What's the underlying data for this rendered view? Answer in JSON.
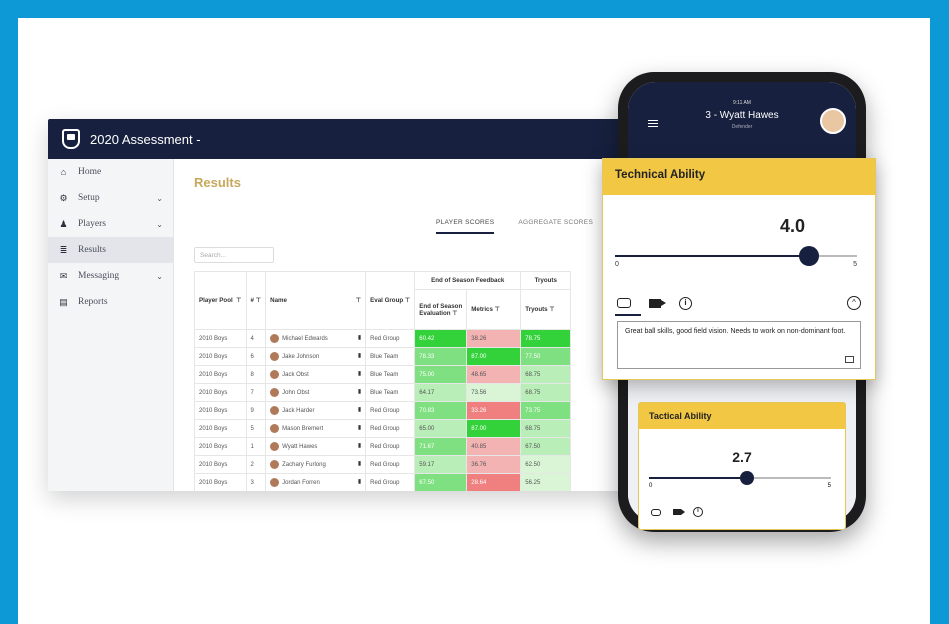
{
  "app": {
    "title": "2020 Assessment -"
  },
  "sidebar": {
    "items": [
      {
        "label": "Home",
        "icon": "home-icon",
        "chev": false
      },
      {
        "label": "Setup",
        "icon": "gear-icon",
        "chev": true
      },
      {
        "label": "Players",
        "icon": "user-icon",
        "chev": true
      },
      {
        "label": "Results",
        "icon": "list-icon",
        "chev": false,
        "active": true
      },
      {
        "label": "Messaging",
        "icon": "envelope-icon",
        "chev": true
      },
      {
        "label": "Reports",
        "icon": "report-icon",
        "chev": false
      }
    ]
  },
  "main": {
    "title": "Results",
    "tabs": [
      "PLAYER SCORES",
      "AGGREGATE SCORES"
    ],
    "search_placeholder": "Search...",
    "table": {
      "group_header": "End of Season Feedback",
      "tryouts_group": "Tryouts",
      "columns": [
        "Player Pool",
        "#",
        "Name",
        "Eval Group",
        "End of Season Evaluation",
        "Metrics",
        "Tryouts"
      ],
      "rows": [
        {
          "pool": "2010 Boys",
          "num": "4",
          "name": "Michael Edwards",
          "group": "Red Group",
          "eval": "60.42",
          "metrics": "38.26",
          "tryouts": "78.75"
        },
        {
          "pool": "2010 Boys",
          "num": "6",
          "name": "Jake Johnson",
          "group": "Blue Team",
          "eval": "78.33",
          "metrics": "87.00",
          "tryouts": "77.50"
        },
        {
          "pool": "2010 Boys",
          "num": "8",
          "name": "Jack Obst",
          "group": "Blue Team",
          "eval": "75.00",
          "metrics": "48.65",
          "tryouts": "68.75"
        },
        {
          "pool": "2010 Boys",
          "num": "7",
          "name": "John Obst",
          "group": "Blue Team",
          "eval": "64.17",
          "metrics": "73.56",
          "tryouts": "68.75"
        },
        {
          "pool": "2010 Boys",
          "num": "9",
          "name": "Jack Harder",
          "group": "Red Group",
          "eval": "70.83",
          "metrics": "33.26",
          "tryouts": "73.75"
        },
        {
          "pool": "2010 Boys",
          "num": "5",
          "name": "Mason Bremert",
          "group": "Red Group",
          "eval": "65.00",
          "metrics": "87.00",
          "tryouts": "68.75"
        },
        {
          "pool": "2010 Boys",
          "num": "1",
          "name": "Wyatt Hawes",
          "group": "Red Group",
          "eval": "71.67",
          "metrics": "40.85",
          "tryouts": "67.50"
        },
        {
          "pool": "2010 Boys",
          "num": "2",
          "name": "Zachary Furlong",
          "group": "Red Group",
          "eval": "59.17",
          "metrics": "36.76",
          "tryouts": "62.50"
        },
        {
          "pool": "2010 Boys",
          "num": "3",
          "name": "Jordan Forren",
          "group": "Red Group",
          "eval": "67.50",
          "metrics": "28.64",
          "tryouts": "56.25"
        }
      ]
    }
  },
  "phone": {
    "status": "9:11 AM",
    "title": "3 - Wyatt Hawes",
    "subtitle": "Defender"
  },
  "technical": {
    "title": "Technical Ability",
    "value": "4.0",
    "level": 0.8,
    "min": "0",
    "max": "5",
    "note": "Great ball skills, good field vision. Needs to work on non-dominant foot."
  },
  "tactical": {
    "title": "Tactical Ability",
    "value": "2.7",
    "level": 0.54,
    "min": "0",
    "max": "5"
  },
  "colors": {
    "navy": "#17213f",
    "gold": "#f2c744",
    "accent_title": "#c8a85a",
    "frame_blue": "#0d98d6"
  }
}
